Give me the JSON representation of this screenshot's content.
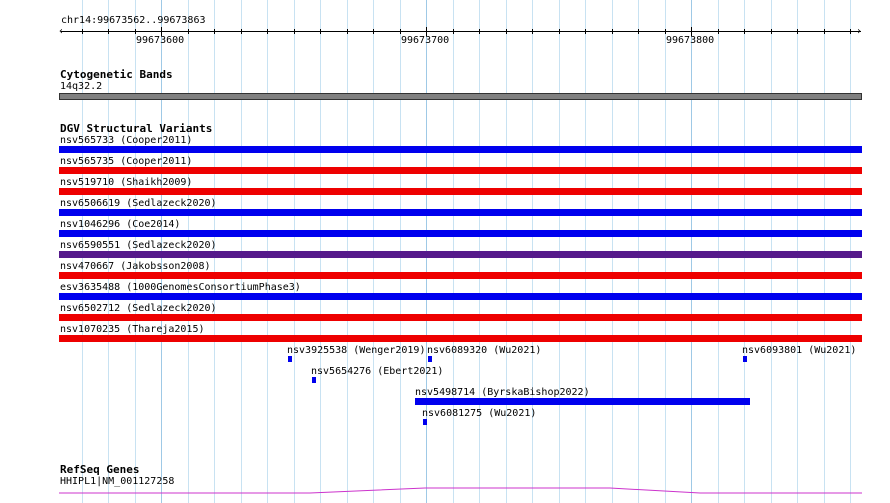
{
  "ruler": {
    "location": "chr14:99673562..99673863",
    "ticks": [
      "99673600",
      "99673700",
      "99673800"
    ]
  },
  "cytoband": {
    "title": "Cytogenetic Bands",
    "band": "14q32.2"
  },
  "dgv": {
    "title": "DGV Structural Variants",
    "variants": [
      {
        "label": "nsv565733 (Cooper2011)",
        "color": "#0000ee"
      },
      {
        "label": "nsv565735 (Cooper2011)",
        "color": "#ee0000"
      },
      {
        "label": "nsv519710 (Shaikh2009)",
        "color": "#ee0000"
      },
      {
        "label": "nsv6506619 (Sedlazeck2020)",
        "color": "#0000ee"
      },
      {
        "label": "nsv1046296 (Coe2014)",
        "color": "#0000ee"
      },
      {
        "label": "nsv6590551 (Sedlazeck2020)",
        "color": "#551a8b"
      },
      {
        "label": "nsv470667 (Jakobsson2008)",
        "color": "#ee0000"
      },
      {
        "label": "esv3635488 (1000GenomesConsortiumPhase3)",
        "color": "#0000ee"
      },
      {
        "label": "nsv6502712 (Sedlazeck2020)",
        "color": "#ee0000"
      },
      {
        "label": "nsv1070235 (Thareja2015)",
        "color": "#ee0000"
      }
    ],
    "small_variants": [
      {
        "label": "nsv3925538 (Wenger2019)",
        "color": "#0000ee"
      },
      {
        "label": "nsv6089320 (Wu2021)",
        "color": "#0000ee"
      },
      {
        "label": "nsv6093801 (Wu2021)",
        "color": "#0000ee"
      },
      {
        "label": "nsv5654276 (Ebert2021)",
        "color": "#0000ee"
      },
      {
        "label": "nsv5498714 (ByrskaBishop2022)",
        "color": "#0000ee"
      },
      {
        "label": "nsv6081275 (Wu2021)",
        "color": "#0000ee"
      }
    ]
  },
  "refseq": {
    "title": "RefSeq Genes",
    "gene": "HHIPL1|NM_001127258",
    "color": "#cc33cc"
  }
}
